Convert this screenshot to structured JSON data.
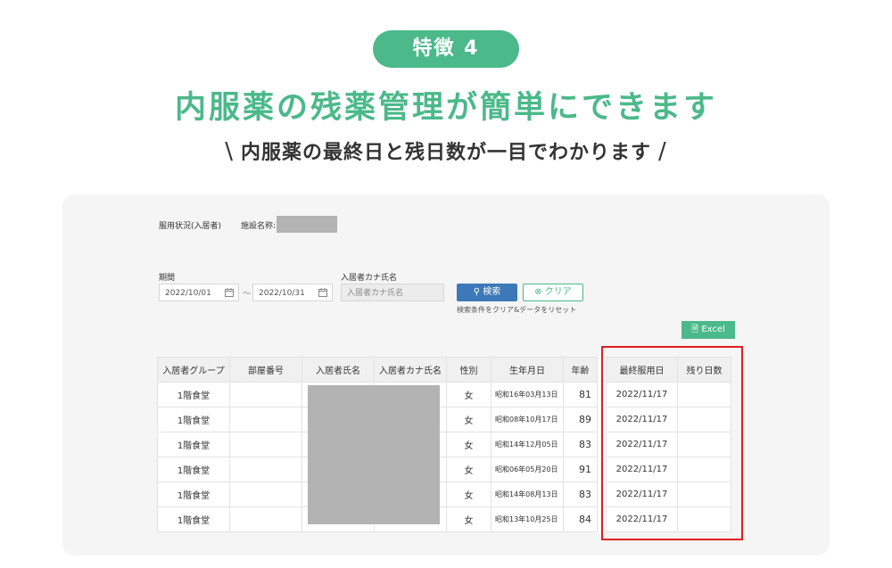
{
  "hero": {
    "badge": "特徴 4",
    "headline": "内服薬の残薬管理が簡単にできます",
    "sub_left": "\\",
    "subline": "内服薬の最終日と残日数が一目でわかります",
    "sub_right": "/"
  },
  "app": {
    "status_label": "服用状況(入居者)",
    "facility_label": "施設名称:",
    "period_label": "期間",
    "date_from": "2022/10/01",
    "date_sep": "～",
    "date_to": "2022/10/31",
    "kana_label": "入居者カナ氏名",
    "kana_placeholder": "入居者カナ氏名",
    "search_label": "検索",
    "clear_label": "クリア",
    "reset_hint": "検索条件をクリア&データをリセット",
    "excel_label": "Excel",
    "columns": [
      "入居者グループ",
      "部屋番号",
      "入居者氏名",
      "入居者カナ氏名",
      "性別",
      "生年月日",
      "年齢",
      "最終服用日",
      "残り日数"
    ],
    "rows": [
      {
        "group": "1階食堂",
        "room": "",
        "sex": "女",
        "birth": "昭和16年03月13日",
        "age": "81",
        "last": "2022/11/17",
        "remain": ""
      },
      {
        "group": "1階食堂",
        "room": "",
        "sex": "女",
        "birth": "昭和08年10月17日",
        "age": "89",
        "last": "2022/11/17",
        "remain": ""
      },
      {
        "group": "1階食堂",
        "room": "",
        "sex": "女",
        "birth": "昭和14年12月05日",
        "age": "83",
        "last": "2022/11/17",
        "remain": ""
      },
      {
        "group": "1階食堂",
        "room": "",
        "sex": "女",
        "birth": "昭和06年05月20日",
        "age": "91",
        "last": "2022/11/17",
        "remain": ""
      },
      {
        "group": "1階食堂",
        "room": "",
        "sex": "女",
        "birth": "昭和14年08月13日",
        "age": "83",
        "last": "2022/11/17",
        "remain": ""
      },
      {
        "group": "1階食堂",
        "room": "",
        "sex": "女",
        "birth": "昭和13年10月25日",
        "age": "84",
        "last": "2022/11/17",
        "remain": ""
      }
    ]
  },
  "colors": {
    "accent": "#4bb98a",
    "primary": "#3d78b8",
    "highlight": "#e02020"
  }
}
